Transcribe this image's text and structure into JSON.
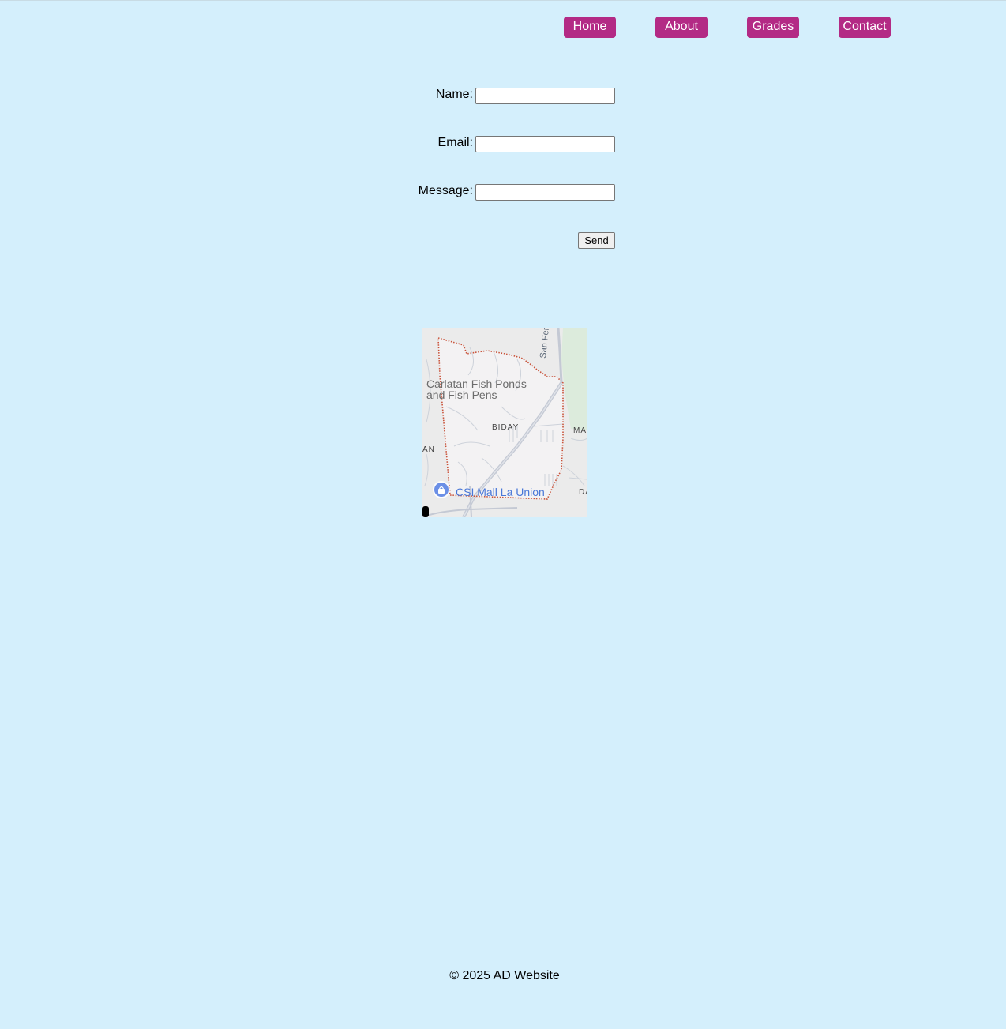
{
  "nav": {
    "items": [
      {
        "label": "Home"
      },
      {
        "label": "About"
      },
      {
        "label": "Grades"
      },
      {
        "label": "Contact"
      }
    ]
  },
  "contact_form": {
    "name_label": "Name:",
    "email_label": "Email:",
    "message_label": "Message:",
    "name_value": "",
    "email_value": "",
    "message_value": "",
    "send_label": "Send"
  },
  "map": {
    "place_fish_ponds_line1": "Carlatan Fish Ponds",
    "place_fish_ponds_line2": "and Fish Pens",
    "barangay": "BIDAY",
    "road": "San Fernando",
    "edge_label_left": "AN",
    "edge_label_right_top": "MA",
    "edge_label_right_bottom": "DA",
    "poi": "CSI Mall La Union",
    "poi_icon": "shopping-bag-icon"
  },
  "footer": {
    "text": "© 2025 AD Website"
  }
}
